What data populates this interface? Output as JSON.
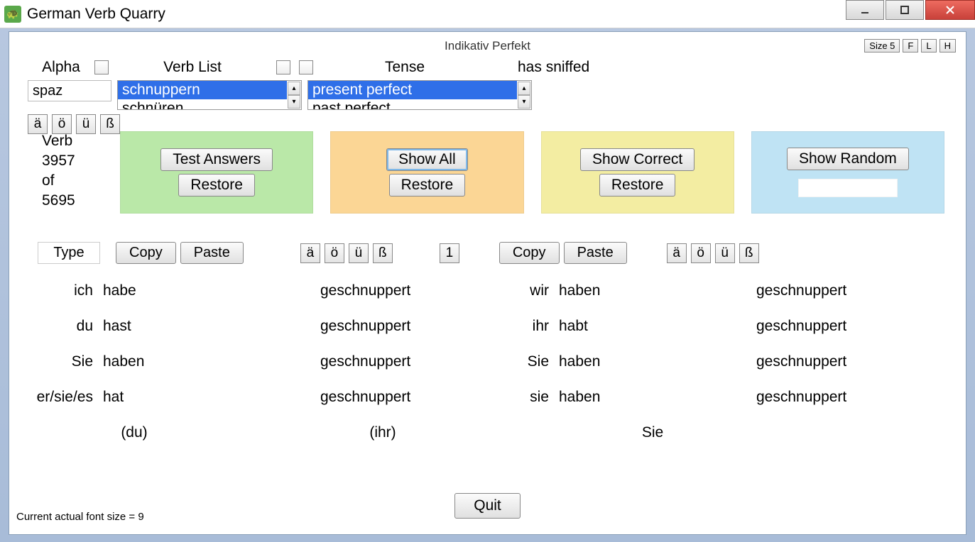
{
  "window": {
    "title": "German Verb Quarry"
  },
  "header": {
    "tense_label": "Indikativ Perfekt",
    "size_btn": "Size 5",
    "f": "F",
    "l": "L",
    "h": "H"
  },
  "selectors": {
    "alpha_label": "Alpha",
    "verb_list_label": "Verb List",
    "tense_label": "Tense",
    "alpha_value": "spaz",
    "translation": "has sniffed",
    "verb_list": {
      "selected": "schnuppern",
      "next": "schnüren"
    },
    "tense_list": {
      "selected": "present perfect",
      "next": "past perfect"
    }
  },
  "chars": {
    "a": "ä",
    "o": "ö",
    "u": "ü",
    "ss": "ß"
  },
  "counter": {
    "l1": "Verb",
    "l2": "3957",
    "l3": "of",
    "l4": "5695"
  },
  "panels": {
    "test": "Test Answers",
    "restore": "Restore",
    "show_all": "Show All",
    "show_correct": "Show Correct",
    "show_random": "Show Random"
  },
  "mid": {
    "type": "Type",
    "copy": "Copy",
    "paste": "Paste",
    "digit": "1"
  },
  "grid": {
    "left": [
      {
        "pron": "ich",
        "aux": "habe",
        "part": "geschnuppert"
      },
      {
        "pron": "du",
        "aux": "hast",
        "part": "geschnuppert"
      },
      {
        "pron": "Sie",
        "aux": "haben",
        "part": "geschnuppert"
      },
      {
        "pron": "er/sie/es",
        "aux": "hat",
        "part": "geschnuppert"
      }
    ],
    "right": [
      {
        "pron": "wir",
        "aux": "haben",
        "part": "geschnuppert"
      },
      {
        "pron": "ihr",
        "aux": "habt",
        "part": "geschnuppert"
      },
      {
        "pron": "Sie",
        "aux": "haben",
        "part": "geschnuppert"
      },
      {
        "pron": "sie",
        "aux": "haben",
        "part": "geschnuppert"
      }
    ],
    "imper": {
      "du": "(du)",
      "ihr": "(ihr)",
      "sie": "Sie"
    }
  },
  "quit": "Quit",
  "footer": "Current actual font size = 9"
}
